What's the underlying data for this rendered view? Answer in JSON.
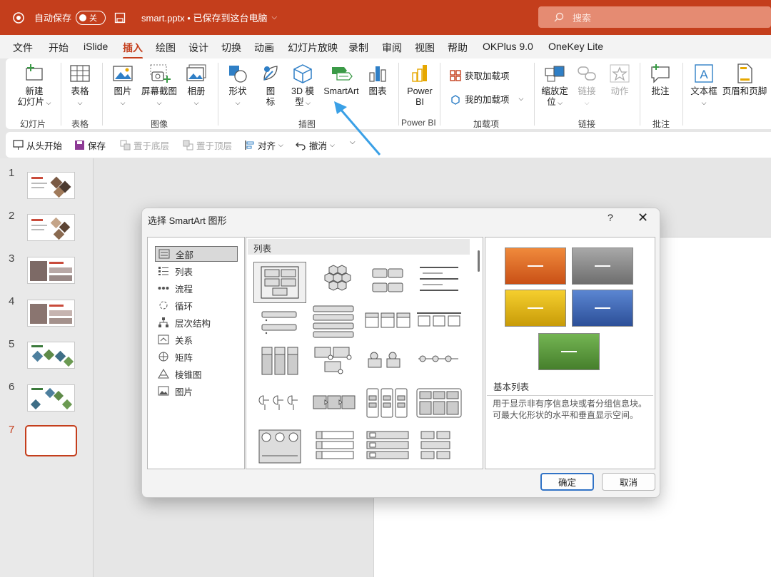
{
  "titlebar": {
    "autosave_label": "自动保存",
    "autosave_state": "关",
    "file_title": "smart.pptx • 已保存到这台电脑",
    "search_placeholder": "搜索"
  },
  "menu": [
    {
      "label": "文件"
    },
    {
      "label": "开始"
    },
    {
      "label": "iSlide"
    },
    {
      "label": "插入",
      "active": true
    },
    {
      "label": "绘图"
    },
    {
      "label": "设计"
    },
    {
      "label": "切换"
    },
    {
      "label": "动画"
    },
    {
      "label": "幻灯片放映"
    },
    {
      "label": "录制"
    },
    {
      "label": "审阅"
    },
    {
      "label": "视图"
    },
    {
      "label": "帮助"
    },
    {
      "label": "OKPlus 9.0"
    },
    {
      "label": "OneKey Lite"
    }
  ],
  "ribbon": {
    "new_slide": "新建\n幻灯片",
    "table": "表格",
    "picture": "图片",
    "screenshot": "屏幕截图",
    "album": "相册",
    "shapes": "形状",
    "icons": "图\n标",
    "model3d": "3D 模\n型",
    "smartart": "SmartArt",
    "chart": "图表",
    "powerbi": "Power\nBI",
    "get_addins": "获取加载项",
    "my_addins": "我的加载项",
    "zoom": "缩放定\n位",
    "link": "链接",
    "action": "动作",
    "comment": "批注",
    "textbox": "文本框",
    "header_footer": "页眉和页脚",
    "groups": {
      "slides": "幻灯片",
      "tables": "表格",
      "images": "图像",
      "illustrations": "插图",
      "powerbi": "Power BI",
      "addins": "加载项",
      "links": "链接",
      "comments": "批注"
    }
  },
  "qat": {
    "from_start": "从头开始",
    "save": "保存",
    "send_back": "置于底层",
    "bring_front": "置于顶层",
    "align": "对齐",
    "undo": "撤消"
  },
  "slides": [
    "1",
    "2",
    "3",
    "4",
    "5",
    "6",
    "7"
  ],
  "dialog": {
    "title": "选择 SmartArt 图形",
    "help": "?",
    "categories": [
      "全部",
      "列表",
      "流程",
      "循环",
      "层次结构",
      "关系",
      "矩阵",
      "棱锥图",
      "图片"
    ],
    "gallery_header": "列表",
    "preview_title": "基本列表",
    "preview_desc": "用于显示非有序信息块或者分组信息块。可最大化形状的水平和垂直显示空间。",
    "ok": "确定",
    "cancel": "取消"
  },
  "colors": {
    "accent": "#c43e1c",
    "orange": "#e06a28",
    "gray": "#8a8a8a",
    "yellow": "#e8b612",
    "blue": "#3d67b5",
    "green": "#5c9d3e",
    "annotation_arrow": "#3aa0e6"
  }
}
